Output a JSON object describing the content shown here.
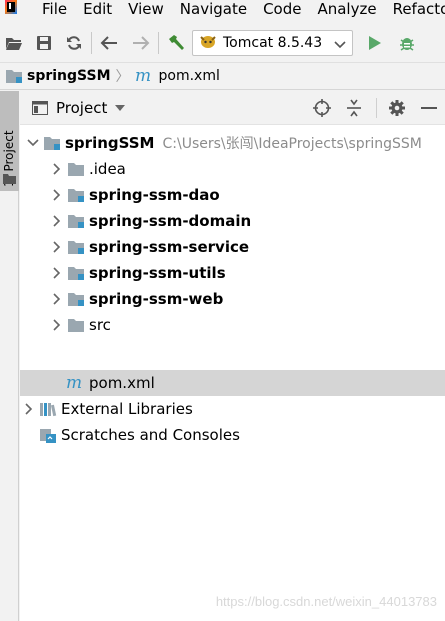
{
  "app": {
    "logo": "intellij-logo-icon"
  },
  "menu": [
    "File",
    "Edit",
    "View",
    "Navigate",
    "Code",
    "Analyze",
    "Refactor"
  ],
  "toolbar": {
    "run_config_label": "Tomcat 8.5.43",
    "icons": [
      "open-folder-icon",
      "save-icon",
      "sync-icon",
      "back-arrow-icon",
      "forward-arrow-icon",
      "build-hammer-icon",
      "tomcat-icon",
      "chevron-down-icon",
      "run-icon",
      "debug-icon"
    ]
  },
  "breadcrumb": [
    {
      "label": "springSSM",
      "icon": "module-folder-icon"
    },
    {
      "label": "pom.xml",
      "icon": "maven-icon"
    }
  ],
  "tool_strip": {
    "label": "1: Project"
  },
  "project_panel": {
    "title": "Project",
    "header_icons": [
      "locate-icon",
      "collapse-all-icon",
      "settings-gear-icon",
      "minimize-icon"
    ]
  },
  "tree": {
    "root": {
      "label": "springSSM",
      "path": "C:\\Users\\张闯\\IdeaProjects\\springSSM"
    },
    "idea": ".idea",
    "modules": [
      "spring-ssm-dao",
      "spring-ssm-domain",
      "spring-ssm-service",
      "spring-ssm-utils",
      "spring-ssm-web"
    ],
    "src": "src",
    "pom": "pom.xml",
    "external_libraries": "External Libraries",
    "scratches": "Scratches and Consoles"
  },
  "colors": {
    "accent_blue": "#3592c4",
    "run_green": "#59a869",
    "selection": "#d5d5d5",
    "folder": "#9aa7b0"
  },
  "watermark": "https://blog.csdn.net/weixin_44013783"
}
